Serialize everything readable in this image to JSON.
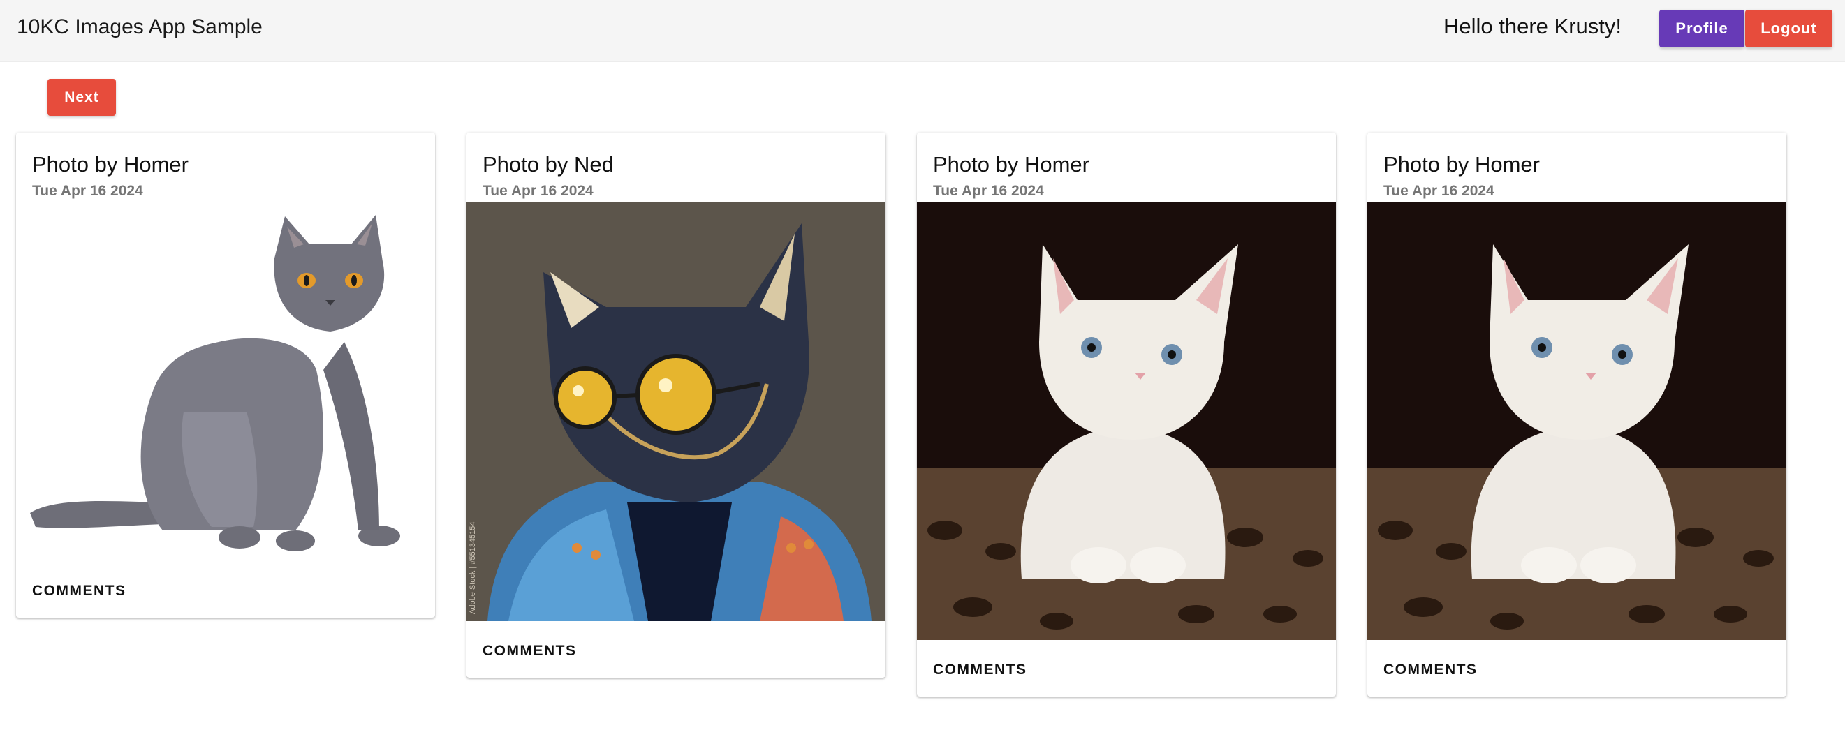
{
  "header": {
    "app_title": "10KC Images App Sample",
    "greeting": "Hello there Krusty!",
    "profile_label": "Profile",
    "logout_label": "Logout"
  },
  "toolbar": {
    "next_label": "Next"
  },
  "colors": {
    "profile_button": "#673ab7",
    "logout_button": "#e74c3c",
    "next_button": "#e74c3c",
    "header_bg": "#f5f5f5"
  },
  "cards": [
    {
      "title": "Photo by Homer",
      "date": "Tue Apr 16 2024",
      "image": "gray-cat-photo",
      "comments_label": "COMMENTS"
    },
    {
      "title": "Photo by Ned",
      "date": "Tue Apr 16 2024",
      "image": "cat-with-sunglasses-illustration",
      "watermark": "Adobe Stock | #551345154",
      "comments_label": "COMMENTS"
    },
    {
      "title": "Photo by Homer",
      "date": "Tue Apr 16 2024",
      "image": "white-kitten-photo",
      "comments_label": "COMMENTS"
    },
    {
      "title": "Photo by Homer",
      "date": "Tue Apr 16 2024",
      "image": "white-kitten-photo",
      "comments_label": "COMMENTS"
    }
  ]
}
